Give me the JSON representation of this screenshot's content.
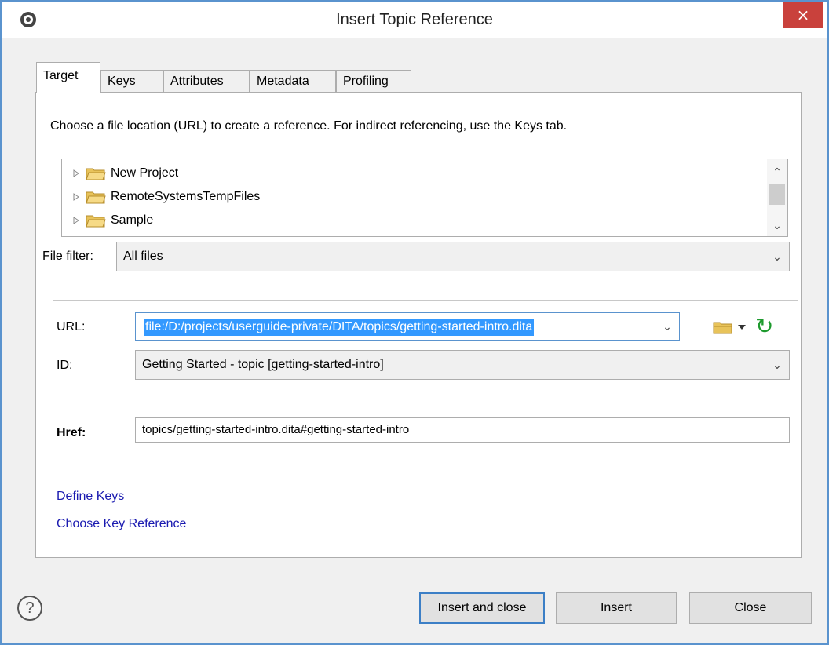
{
  "window": {
    "title": "Insert Topic Reference",
    "close_glyph": "×"
  },
  "tabs": [
    {
      "label": "Target",
      "active": true
    },
    {
      "label": "Keys",
      "active": false
    },
    {
      "label": "Attributes",
      "active": false
    },
    {
      "label": "Metadata",
      "active": false
    },
    {
      "label": "Profiling",
      "active": false
    }
  ],
  "target": {
    "description": "Choose a file location (URL) to create a reference. For indirect referencing, use the Keys tab.",
    "tree": [
      {
        "label": "New Project",
        "icon": "folder-icon"
      },
      {
        "label": "RemoteSystemsTempFiles",
        "icon": "folder-icon"
      },
      {
        "label": "Sample",
        "icon": "folder-icon"
      }
    ],
    "file_filter": {
      "label": "File filter:",
      "value": "All files"
    },
    "url": {
      "label": "URL:",
      "value": "file:/D:/projects/userguide-private/DITA/topics/getting-started-intro.dita"
    },
    "id": {
      "label": "ID:",
      "value": "Getting Started - topic [getting-started-intro]"
    },
    "href": {
      "label": "Href:",
      "value": "topics/getting-started-intro.dita#getting-started-intro"
    },
    "links": {
      "define_keys": "Define Keys",
      "choose_key_reference": "Choose Key Reference"
    }
  },
  "buttons": {
    "insert_and_close": "Insert and close",
    "insert": "Insert",
    "close": "Close"
  },
  "help": {
    "glyph": "?"
  },
  "colors": {
    "accent": "#3c7fc6",
    "close_button": "#c9413c",
    "selection": "#3399ff",
    "link": "#1a1ab0",
    "refresh": "#1e9a2e",
    "folder": "#e8c35a"
  }
}
